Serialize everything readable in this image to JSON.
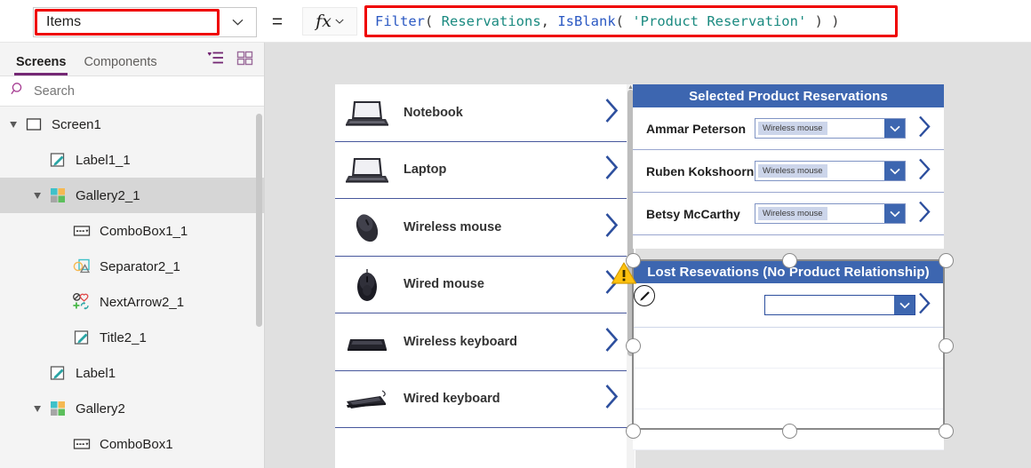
{
  "formula_bar": {
    "property_value": "Items",
    "property_caret_icon": "chevron-down-icon",
    "equals": "=",
    "fx_label": "fx",
    "fx_caret_icon": "chevron-down-icon",
    "formula_tokens": [
      {
        "t": "Filter",
        "k": "fn"
      },
      {
        "t": "( ",
        "k": "pun"
      },
      {
        "t": "Reservations",
        "k": "tbl"
      },
      {
        "t": ", ",
        "k": "pun"
      },
      {
        "t": "IsBlank",
        "k": "fn"
      },
      {
        "t": "( ",
        "k": "pun"
      },
      {
        "t": "'Product Reservation'",
        "k": "str"
      },
      {
        "t": " ) )",
        "k": "pun"
      }
    ],
    "formula_plain": "Filter( Reservations, IsBlank( 'Product Reservation' ) )",
    "highlight_color": "#ef0000"
  },
  "sidebar": {
    "tabs": [
      {
        "label": "Screens",
        "active": true
      },
      {
        "label": "Components",
        "active": false
      }
    ],
    "view_icons": [
      {
        "name": "tree-view-icon"
      },
      {
        "name": "thumbnail-view-icon"
      }
    ],
    "search": {
      "placeholder": "Search",
      "icon": "search-icon"
    },
    "accent_color": "#742774",
    "tree": [
      {
        "label": "Screen1",
        "icon": "screen-icon",
        "depth": 0,
        "expanded": true,
        "selected": false
      },
      {
        "label": "Label1_1",
        "icon": "label-icon",
        "depth": 1,
        "expanded": null,
        "selected": false
      },
      {
        "label": "Gallery2_1",
        "icon": "gallery-icon",
        "depth": 1,
        "expanded": true,
        "selected": true
      },
      {
        "label": "ComboBox1_1",
        "icon": "combobox-icon",
        "depth": 2,
        "expanded": null,
        "selected": false
      },
      {
        "label": "Separator2_1",
        "icon": "separator-icon",
        "depth": 2,
        "expanded": null,
        "selected": false
      },
      {
        "label": "NextArrow2_1",
        "icon": "nextarrow-icon",
        "depth": 2,
        "expanded": null,
        "selected": false
      },
      {
        "label": "Title2_1",
        "icon": "label-icon",
        "depth": 2,
        "expanded": null,
        "selected": false
      },
      {
        "label": "Label1",
        "icon": "label-icon",
        "depth": 1,
        "expanded": null,
        "selected": false
      },
      {
        "label": "Gallery2",
        "icon": "gallery-icon",
        "depth": 1,
        "expanded": true,
        "selected": false
      },
      {
        "label": "ComboBox1",
        "icon": "combobox-icon",
        "depth": 2,
        "expanded": null,
        "selected": false
      }
    ]
  },
  "canvas": {
    "background_color": "#e0e0e0",
    "product_gallery": {
      "chevron_icon": "chevron-right-icon",
      "items": [
        {
          "name": "Notebook",
          "image": "notebook-photo"
        },
        {
          "name": "Laptop",
          "image": "laptop-photo"
        },
        {
          "name": "Wireless mouse",
          "image": "wireless-mouse-photo"
        },
        {
          "name": "Wired mouse",
          "image": "wired-mouse-photo"
        },
        {
          "name": "Wireless keyboard",
          "image": "wireless-keyboard-photo"
        },
        {
          "name": "Wired keyboard",
          "image": "wired-keyboard-photo"
        }
      ]
    },
    "selected_reservations": {
      "header": "Selected Product Reservations",
      "header_color": "#3d66b0",
      "rows": [
        {
          "person": "Ammar Peterson",
          "product": "Wireless mouse"
        },
        {
          "person": "Ruben Kokshoorn",
          "product": "Wireless mouse"
        },
        {
          "person": "Betsy McCarthy",
          "product": "Wireless mouse"
        }
      ]
    },
    "lost_reservations": {
      "header": "Lost Resevations (No Product Relationship)",
      "header_color": "#3d66b0",
      "rows": [
        {
          "person": "",
          "product": ""
        }
      ],
      "blank_row_count": 3
    },
    "warning_icon": "warning-triangle-icon",
    "edit_badge_icon": "edit-pencil-icon",
    "selection_handle_icon": "resize-handle"
  }
}
